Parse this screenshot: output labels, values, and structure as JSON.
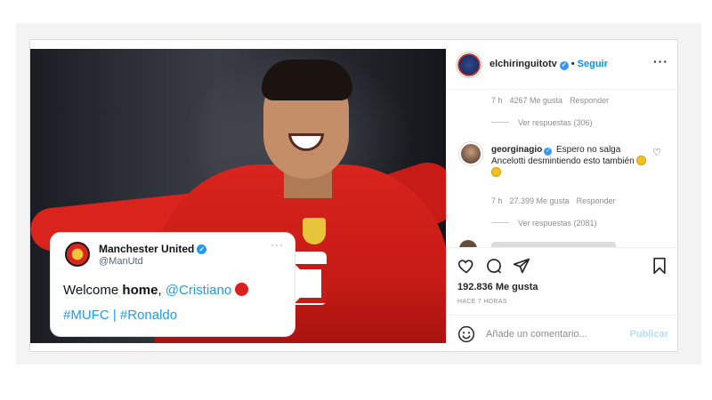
{
  "account": {
    "username": "elchiringuitotv",
    "follow_label": "Seguir",
    "separator": "•"
  },
  "comments": {
    "first_meta": {
      "time": "7 h",
      "likes": "4267 Me gusta",
      "reply": "Responder"
    },
    "first_replies": "Ver respuestas (306)",
    "second": {
      "username": "georginagio",
      "text": "Espero no salga Ancelotti desmintiendo esto también",
      "meta": {
        "time": "7 h",
        "likes": "27.399 Me gusta",
        "reply": "Responder"
      },
      "replies": "Ver respuestas (2081)"
    }
  },
  "post": {
    "likes": "192.836 Me gusta",
    "time_ago": "HACE 7 HORAS",
    "comment_placeholder": "Añade un comentario...",
    "publish_label": "Publicar"
  },
  "tweet": {
    "name": "Manchester United",
    "handle": "@ManUtd",
    "more": "···",
    "text_prefix": "Welcome ",
    "text_bold": "home",
    "text_comma": ", ",
    "mention": "@Cristiano",
    "hashtags": "#MUFC | #Ronaldo"
  },
  "icons": {
    "header_menu": "more-horizontal-icon",
    "like": "heart-icon",
    "comment": "comment-icon",
    "share": "paper-plane-icon",
    "save": "bookmark-icon",
    "emoji": "smile-icon"
  },
  "colors": {
    "instagram_blue": "#0095f6",
    "twitter_blue": "#1d9bf0",
    "united_red": "#d8241d"
  }
}
